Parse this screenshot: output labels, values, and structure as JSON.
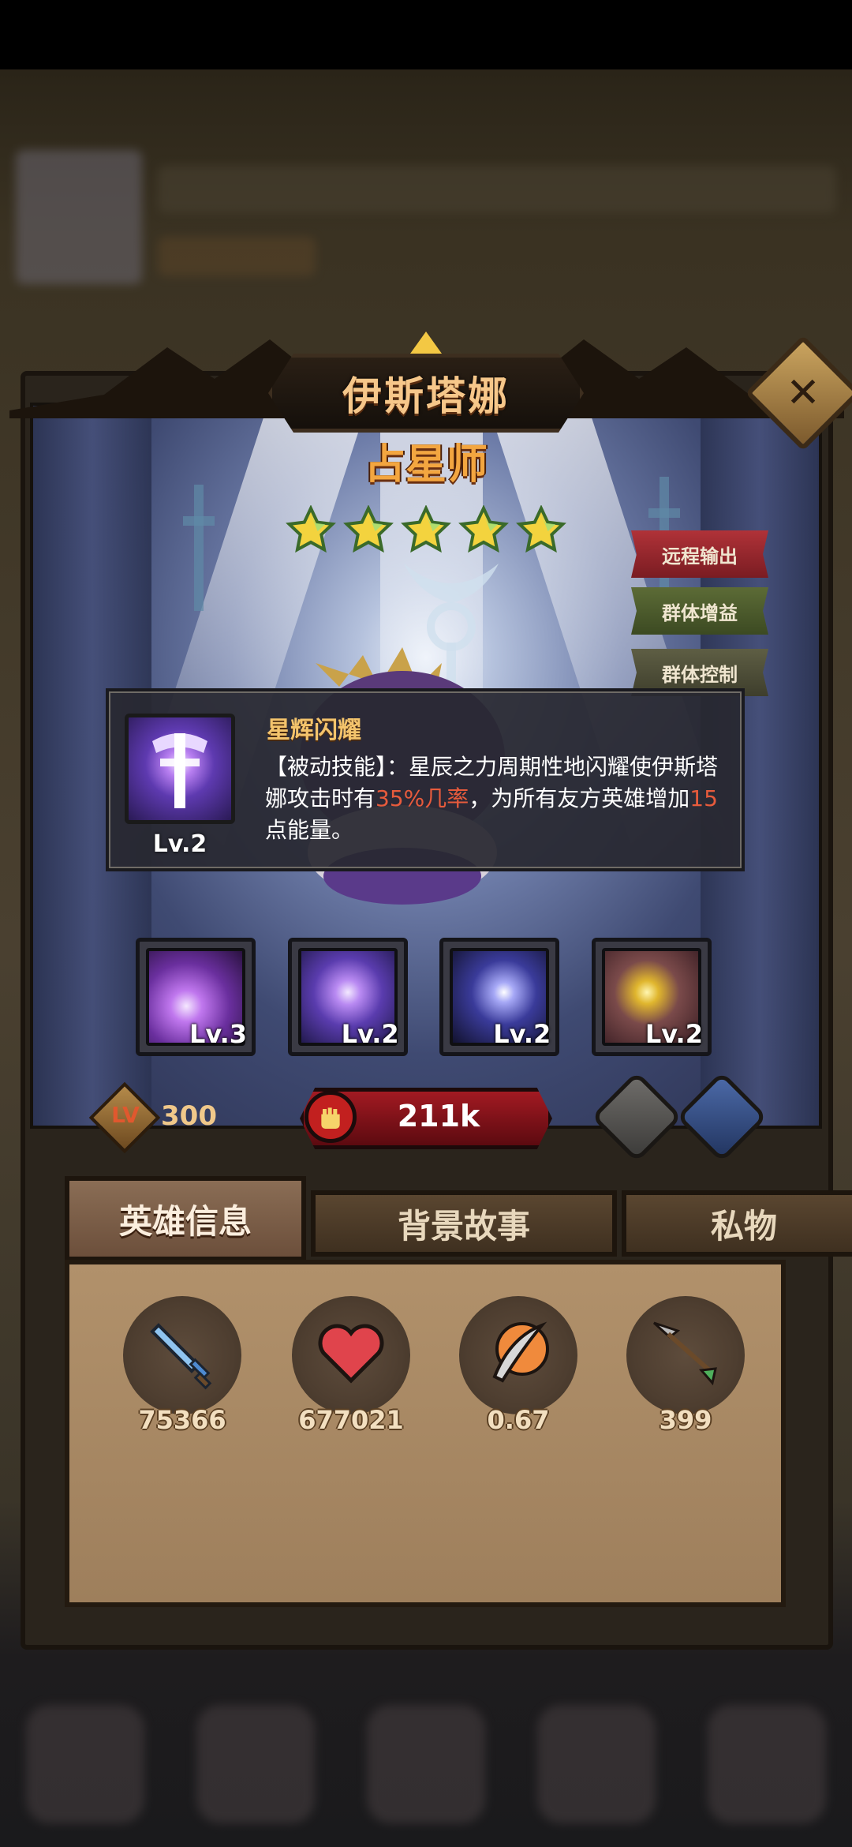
{
  "hero": {
    "name": "伊斯塔娜",
    "class": "占星师",
    "stars": 5,
    "tags": [
      "远程输出",
      "群体增益",
      "群体控制"
    ],
    "level_label": "LV",
    "level": "300",
    "power": "211k"
  },
  "tooltip": {
    "skill_name": "星辉闪耀",
    "level": "Lv.2",
    "desc_part1": "【被动技能】：星辰之力周期性地闪耀使伊斯塔娜攻击时有",
    "desc_highlight1": "35%几率",
    "desc_part2": "，为所有友方英雄增加",
    "desc_highlight2": "15",
    "desc_part3": "点能量。"
  },
  "skills": [
    {
      "level": "Lv.3",
      "icon": "purple-burst-skill-icon"
    },
    {
      "level": "Lv.2",
      "icon": "star-cross-skill-icon"
    },
    {
      "level": "Lv.2",
      "icon": "crescent-moon-skill-icon"
    },
    {
      "level": "Lv.2",
      "icon": "golden-lightning-skill-icon"
    }
  ],
  "tabs": [
    "英雄信息",
    "背景故事",
    "私物"
  ],
  "stats": [
    {
      "icon": "sword-icon",
      "value": "75366"
    },
    {
      "icon": "heart-icon",
      "value": "677021"
    },
    {
      "icon": "attack-speed-icon",
      "value": "0.67"
    },
    {
      "icon": "arrow-range-icon",
      "value": "399"
    }
  ],
  "close_symbol": "✕",
  "colors": {
    "title_gold": "#f6c78a",
    "class_orange": "#f3a640",
    "highlight_red": "#e75b3c",
    "tag_ranged": "#9a2a2e",
    "tag_buff": "#4a5a2e",
    "tag_control": "#50503a",
    "power_red": "#a21a22"
  }
}
